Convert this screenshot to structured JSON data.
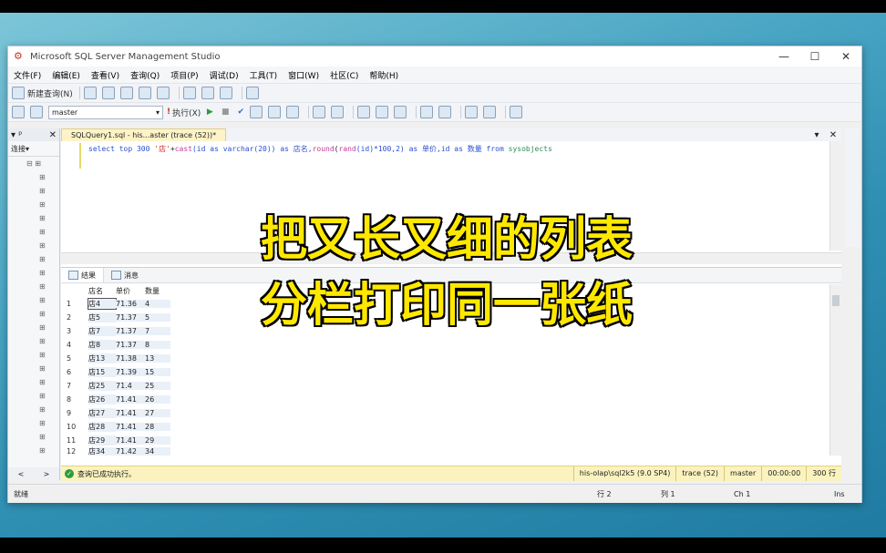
{
  "window": {
    "title": "Microsoft SQL Server Management Studio",
    "minimize": "—",
    "maximize": "☐",
    "close": "✕"
  },
  "menu": [
    "文件(F)",
    "编辑(E)",
    "查看(V)",
    "查询(Q)",
    "项目(P)",
    "调试(D)",
    "工具(T)",
    "窗口(W)",
    "社区(C)",
    "帮助(H)"
  ],
  "toolbar1": {
    "new_query": "新建查询(N)"
  },
  "toolbar2": {
    "database": "master",
    "execute": "执行(X)"
  },
  "left_panel": {
    "connect": "连接▾",
    "pin": "▾ ᵖ",
    "close": "✕",
    "scroll_left": "<",
    "scroll_right": ">"
  },
  "doc_tab": {
    "label": "SQLQuery1.sql - his...aster (trace (52))*"
  },
  "editor": {
    "line": {
      "p1": "select top 300 ",
      "p2": "'店'",
      "p3": "+",
      "p4": "cast",
      "p5": "(id as varchar(20)) as 店名,",
      "p6": "round",
      "p7": "(",
      "p8": "rand",
      "p9": "(id)*100,2) as 单价,id as 数量 from ",
      "p10": "sysobjects"
    }
  },
  "results": {
    "tabs": [
      "结果",
      "消息"
    ],
    "columns": [
      "店名",
      "单价",
      "数量"
    ],
    "rows": [
      [
        "1",
        "店4",
        "71.36",
        "4"
      ],
      [
        "2",
        "店5",
        "71.37",
        "5"
      ],
      [
        "3",
        "店7",
        "71.37",
        "7"
      ],
      [
        "4",
        "店8",
        "71.37",
        "8"
      ],
      [
        "5",
        "店13",
        "71.38",
        "13"
      ],
      [
        "6",
        "店15",
        "71.39",
        "15"
      ],
      [
        "7",
        "店25",
        "71.4",
        "25"
      ],
      [
        "8",
        "店26",
        "71.41",
        "26"
      ],
      [
        "9",
        "店27",
        "71.41",
        "27"
      ],
      [
        "10",
        "店28",
        "71.41",
        "28"
      ],
      [
        "11",
        "店29",
        "71.41",
        "29"
      ],
      [
        "12",
        "店34",
        "71.42",
        "34"
      ]
    ]
  },
  "query_status": {
    "message": "查询已成功执行。",
    "server": "his-olap\\sql2k5 (9.0 SP4)",
    "session": "trace (52)",
    "db": "master",
    "time": "00:00:00",
    "rows": "300 行"
  },
  "status_bar": {
    "ready": "就绪",
    "row": "行 2",
    "col": "列 1",
    "ch": "Ch 1",
    "mode": "Ins"
  },
  "overlay": {
    "line1": "把又长又细的列表",
    "line2": "分栏打印同一张纸"
  }
}
